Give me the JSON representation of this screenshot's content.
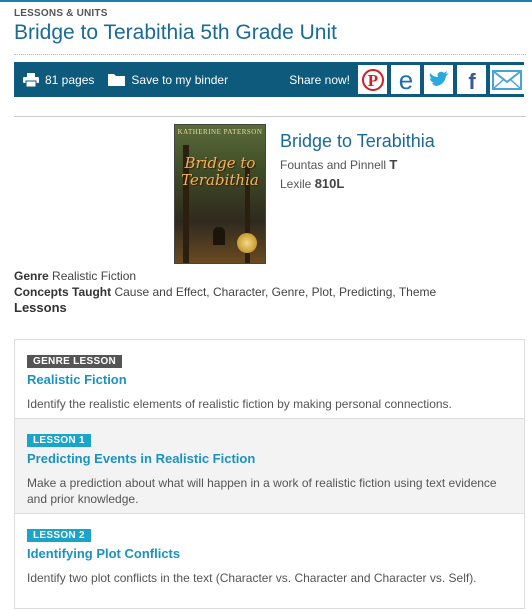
{
  "header": {
    "eyebrow": "LESSONS & UNITS",
    "title": "Bridge to Terabithia 5th Grade Unit"
  },
  "toolbar": {
    "pages_label": "81 pages",
    "binder_label": "Save to my binder",
    "share_label": "Share now!",
    "social": [
      "pinterest-icon",
      "edmodo-icon",
      "twitter-icon",
      "facebook-icon",
      "email-icon"
    ],
    "colors": {
      "bar": "#0d5a7c",
      "pinterest": "#cb2027",
      "edmodo": "#1f6fb2",
      "twitter": "#2aa9e0",
      "facebook": "#3b5998",
      "email": "#4aa3d8"
    }
  },
  "book": {
    "cover_author": "KATHERINE PATERSON",
    "cover_title": "Bridge to Terabithia",
    "title": "Bridge to Terabithia",
    "fp_label": "Fountas and Pinnell",
    "fp_value": "T",
    "lexile_label": "Lexile",
    "lexile_value": "810L"
  },
  "details": {
    "genre_label": "Genre",
    "genre_value": "Realistic Fiction",
    "concepts_label": "Concepts Taught",
    "concepts_value": "Cause and Effect, Character, Genre, Plot, Predicting, Theme",
    "lessons_heading": "Lessons"
  },
  "lessons": [
    {
      "badge": "GENRE LESSON",
      "title": "Realistic Fiction",
      "description": "Identify the realistic elements of realistic fiction by making personal connections."
    },
    {
      "badge": "LESSON 1",
      "title": "Predicting Events in Realistic Fiction",
      "description": "Make a prediction about what will happen in a work of realistic fiction using text evidence and prior knowledge."
    },
    {
      "badge": "LESSON 2",
      "title": "Identifying Plot Conflicts",
      "description": "Identify two plot conflicts in the text (Character vs. Character and Character vs. Self)."
    }
  ]
}
